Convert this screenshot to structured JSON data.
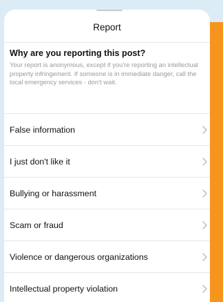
{
  "sheet": {
    "title": "Report",
    "question": "Why are you reporting this post?",
    "note": "Your report is anonymous, except if you're reporting an intellectual property infringement. If someone is in immediate danger, call the local emergency services - don't wait."
  },
  "reasons": [
    {
      "label": "False information",
      "icon": "chevron-right-icon"
    },
    {
      "label": "I just don't like it",
      "icon": "chevron-right-icon"
    },
    {
      "label": "Bullying or harassment",
      "icon": "chevron-right-icon"
    },
    {
      "label": "Scam or fraud",
      "icon": "chevron-right-icon"
    },
    {
      "label": "Violence or dangerous organizations",
      "icon": "chevron-right-icon"
    },
    {
      "label": "Intellectual property violation",
      "icon": "chevron-right-icon"
    }
  ],
  "colors": {
    "background": "#dcecf7",
    "accent": "#f7941d",
    "sheet": "#ffffff",
    "muted_text": "#9b9b9b",
    "divider": "#e7e7e7"
  }
}
